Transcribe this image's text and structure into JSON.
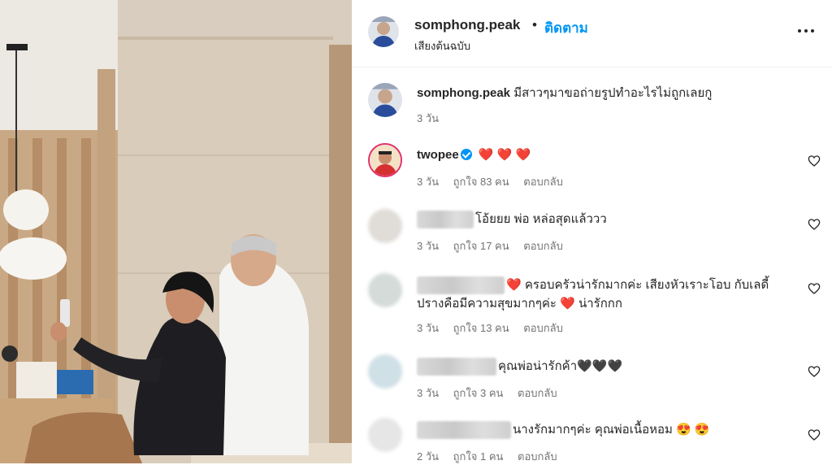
{
  "post": {
    "username": "somphong.peak",
    "follow_label": "ติดตาม",
    "dot": "•",
    "audio": "เสียงต้นฉบับ"
  },
  "caption": {
    "username": "somphong.peak",
    "text": "มีสาวๆมาขอถ่ายรูปทำอะไรไม่ถูกเลยกู",
    "time": "3 วัน"
  },
  "comments": [
    {
      "username": "twopee",
      "text": "❤️ ❤️ ❤️",
      "time": "3 วัน",
      "likes": "ถูกใจ 83 คน",
      "reply": "ตอบกลับ"
    },
    {
      "username": "",
      "text": "โอ้ยยย พ่อ หล่อสุดแล้ววว",
      "time": "3 วัน",
      "likes": "ถูกใจ 17 คน",
      "reply": "ตอบกลับ"
    },
    {
      "username": "",
      "text_line1": "❤️ ครอบครัวน่ารักมากค่ะ เสียงหัวเราะโอบ กับเลดี้",
      "text_line2": "ปรางคือมีความสุขมากๆค่ะ ❤️ น่ารักกก",
      "time": "3 วัน",
      "likes": "ถูกใจ 13 คน",
      "reply": "ตอบกลับ"
    },
    {
      "username": "",
      "text": "คุณพ่อน่ารักค้า🖤🖤🖤",
      "time": "3 วัน",
      "likes": "ถูกใจ 3 คน",
      "reply": "ตอบกลับ"
    },
    {
      "username": "",
      "text": "นางรักมากๆค่ะ คุณพ่อเนื้อหอม 😍 😍",
      "time": "2 วัน",
      "likes": "ถูกใจ 1 คน",
      "reply": "ตอบกลับ"
    }
  ],
  "icons": {
    "more": "more-horizontal-icon",
    "like": "heart-outline-icon",
    "verified": "verified-badge-icon"
  },
  "colors": {
    "accent": "#0095f6",
    "meta": "#737373",
    "text": "#262626"
  }
}
